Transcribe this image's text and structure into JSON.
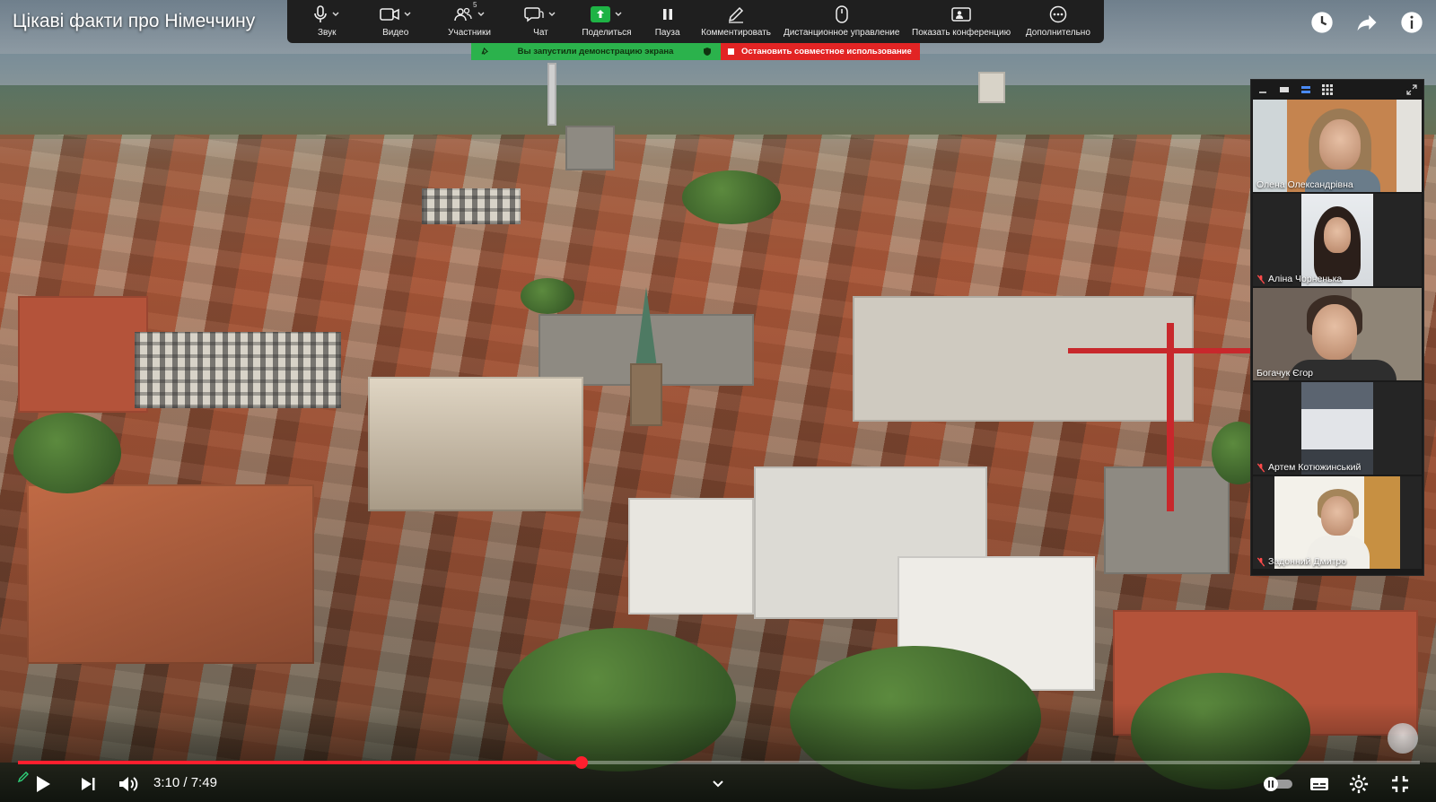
{
  "video": {
    "title": "Цікаві факти про Німеччину",
    "current_time": "3:10",
    "separator": "/",
    "duration": "7:49",
    "progress": 0.402
  },
  "zoom_toolbar": {
    "items": [
      {
        "label": "Звук",
        "icon": "microphone-icon",
        "has_menu": true
      },
      {
        "label": "Видео",
        "icon": "video-camera-icon",
        "has_menu": true
      },
      {
        "label": "Участники",
        "icon": "participants-icon",
        "count": "5",
        "has_menu": true
      },
      {
        "label": "Чат",
        "icon": "chat-icon",
        "has_menu": true
      },
      {
        "label": "Поделиться",
        "icon": "share-screen-icon",
        "has_menu": true
      },
      {
        "label": "Пауза",
        "icon": "pause-icon",
        "has_menu": false
      },
      {
        "label": "Комментировать",
        "icon": "annotate-pen-icon",
        "has_menu": false
      },
      {
        "label": "Дистанционное управление",
        "icon": "remote-control-icon",
        "has_menu": false
      },
      {
        "label": "Показать конференцию",
        "icon": "show-meeting-icon",
        "has_menu": false
      },
      {
        "label": "Дополнительно",
        "icon": "more-icon",
        "has_menu": false
      }
    ]
  },
  "share_banner": {
    "status": "Вы запустили демонстрацию экрана",
    "stop": "Остановить совместное использование"
  },
  "participants": [
    {
      "name": "Олена Олександрівна",
      "muted": false,
      "active": false
    },
    {
      "name": "Аліна Чорненька",
      "muted": true,
      "active": false
    },
    {
      "name": "Богачук Єгор",
      "muted": false,
      "active": true
    },
    {
      "name": "Артем Котюжинський",
      "muted": true,
      "active": false
    },
    {
      "name": "Задонний Дмитро",
      "muted": true,
      "active": false
    }
  ],
  "colors": {
    "progress": "#ff1f2e",
    "share_on": "#2bb24c",
    "share_stop": "#e22424",
    "active_speaker": "#2fd17a"
  }
}
